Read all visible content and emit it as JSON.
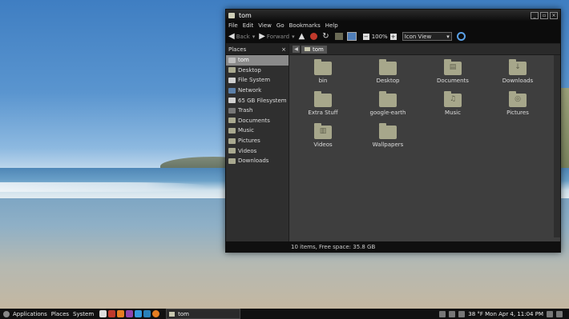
{
  "window": {
    "title": "tom",
    "controls": [
      "_",
      "▫",
      "×"
    ]
  },
  "menubar": [
    "File",
    "Edit",
    "View",
    "Go",
    "Bookmarks",
    "Help"
  ],
  "toolbar": {
    "back": "Back",
    "forward": "Forward",
    "zoom": "100%",
    "view_mode": "Icon View"
  },
  "sidebar": {
    "header": "Places",
    "close": "×",
    "items": [
      {
        "label": "tom",
        "icon": "home-icon",
        "selected": true
      },
      {
        "label": "Desktop",
        "icon": "folder-icon"
      },
      {
        "label": "File System",
        "icon": "drive-icon"
      },
      {
        "label": "Network",
        "icon": "network-icon"
      },
      {
        "label": "65 GB Filesystem",
        "icon": "drive-icon"
      },
      {
        "label": "Trash",
        "icon": "trash-icon"
      },
      {
        "label": "Documents",
        "icon": "folder-icon"
      },
      {
        "label": "Music",
        "icon": "folder-icon"
      },
      {
        "label": "Pictures",
        "icon": "folder-icon"
      },
      {
        "label": "Videos",
        "icon": "folder-icon"
      },
      {
        "label": "Downloads",
        "icon": "folder-icon"
      }
    ]
  },
  "pathbar": {
    "crumb": "tom"
  },
  "files": [
    {
      "label": "bin",
      "glyph": ""
    },
    {
      "label": "Desktop",
      "glyph": ""
    },
    {
      "label": "Documents",
      "glyph": "▤"
    },
    {
      "label": "Downloads",
      "glyph": "↓"
    },
    {
      "label": "Extra Stuff",
      "glyph": ""
    },
    {
      "label": "google-earth",
      "glyph": ""
    },
    {
      "label": "Music",
      "glyph": "♫"
    },
    {
      "label": "Pictures",
      "glyph": "◎"
    },
    {
      "label": "Videos",
      "glyph": "▥"
    },
    {
      "label": "Wallpapers",
      "glyph": ""
    }
  ],
  "status": "10 items, Free space: 35.8 GB",
  "taskbar": {
    "menus": [
      "Applications",
      "Places",
      "System"
    ],
    "task_label": "tom",
    "clock": "38 °F Mon Apr 4, 11:04 PM"
  }
}
